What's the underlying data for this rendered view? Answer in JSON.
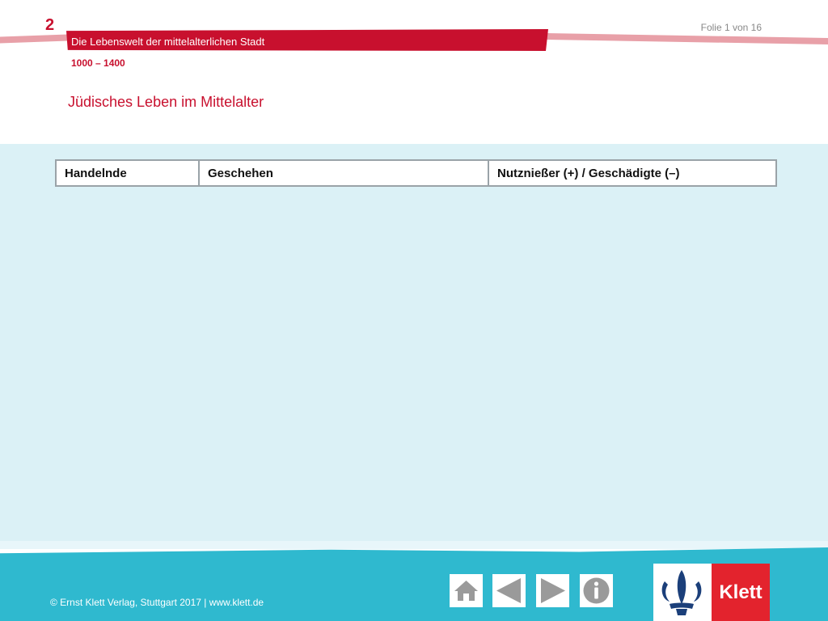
{
  "header": {
    "chapter_number": "2",
    "chapter_title": "Die Lebenswelt der mittelalterlichen Stadt",
    "period": "1000 – 1400",
    "slide_counter": "Folie 1 von 16",
    "page_title": "Jüdisches Leben im Mittelalter"
  },
  "table": {
    "columns": [
      "Handelnde",
      "Geschehen",
      "Nutznießer (+) / Geschädigte (–)"
    ]
  },
  "footer": {
    "copyright": "© Ernst Klett Verlag, Stuttgart 2017 | www.klett.de",
    "nav": {
      "home_icon": "home-icon",
      "prev_icon": "triangle-left-icon",
      "next_icon": "triangle-right-icon",
      "info_icon": "info-icon"
    },
    "logo_text": "Klett"
  },
  "colors": {
    "accent_red": "#c8102e",
    "content_bg": "#dbf1f6",
    "footer_bg": "#2fb9cf",
    "logo_red": "#e3232d"
  }
}
